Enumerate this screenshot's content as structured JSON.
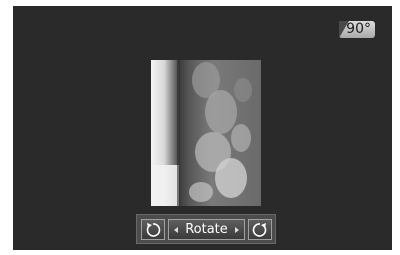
{
  "screen": {
    "angle_label": "90°",
    "photo_icon": "rotated-sky-photo",
    "toolbar": {
      "rotate_ccw_icon": "rotate-counterclockwise-icon",
      "rotate_label": "Rotate",
      "prev_icon": "triangle-left-icon",
      "next_icon": "triangle-right-icon",
      "rotate_cw_icon": "rotate-clockwise-icon"
    },
    "colors": {
      "background": "#2a2a2a",
      "badge": "#c8c8c8",
      "toolbar": "#4c4c4c"
    }
  }
}
